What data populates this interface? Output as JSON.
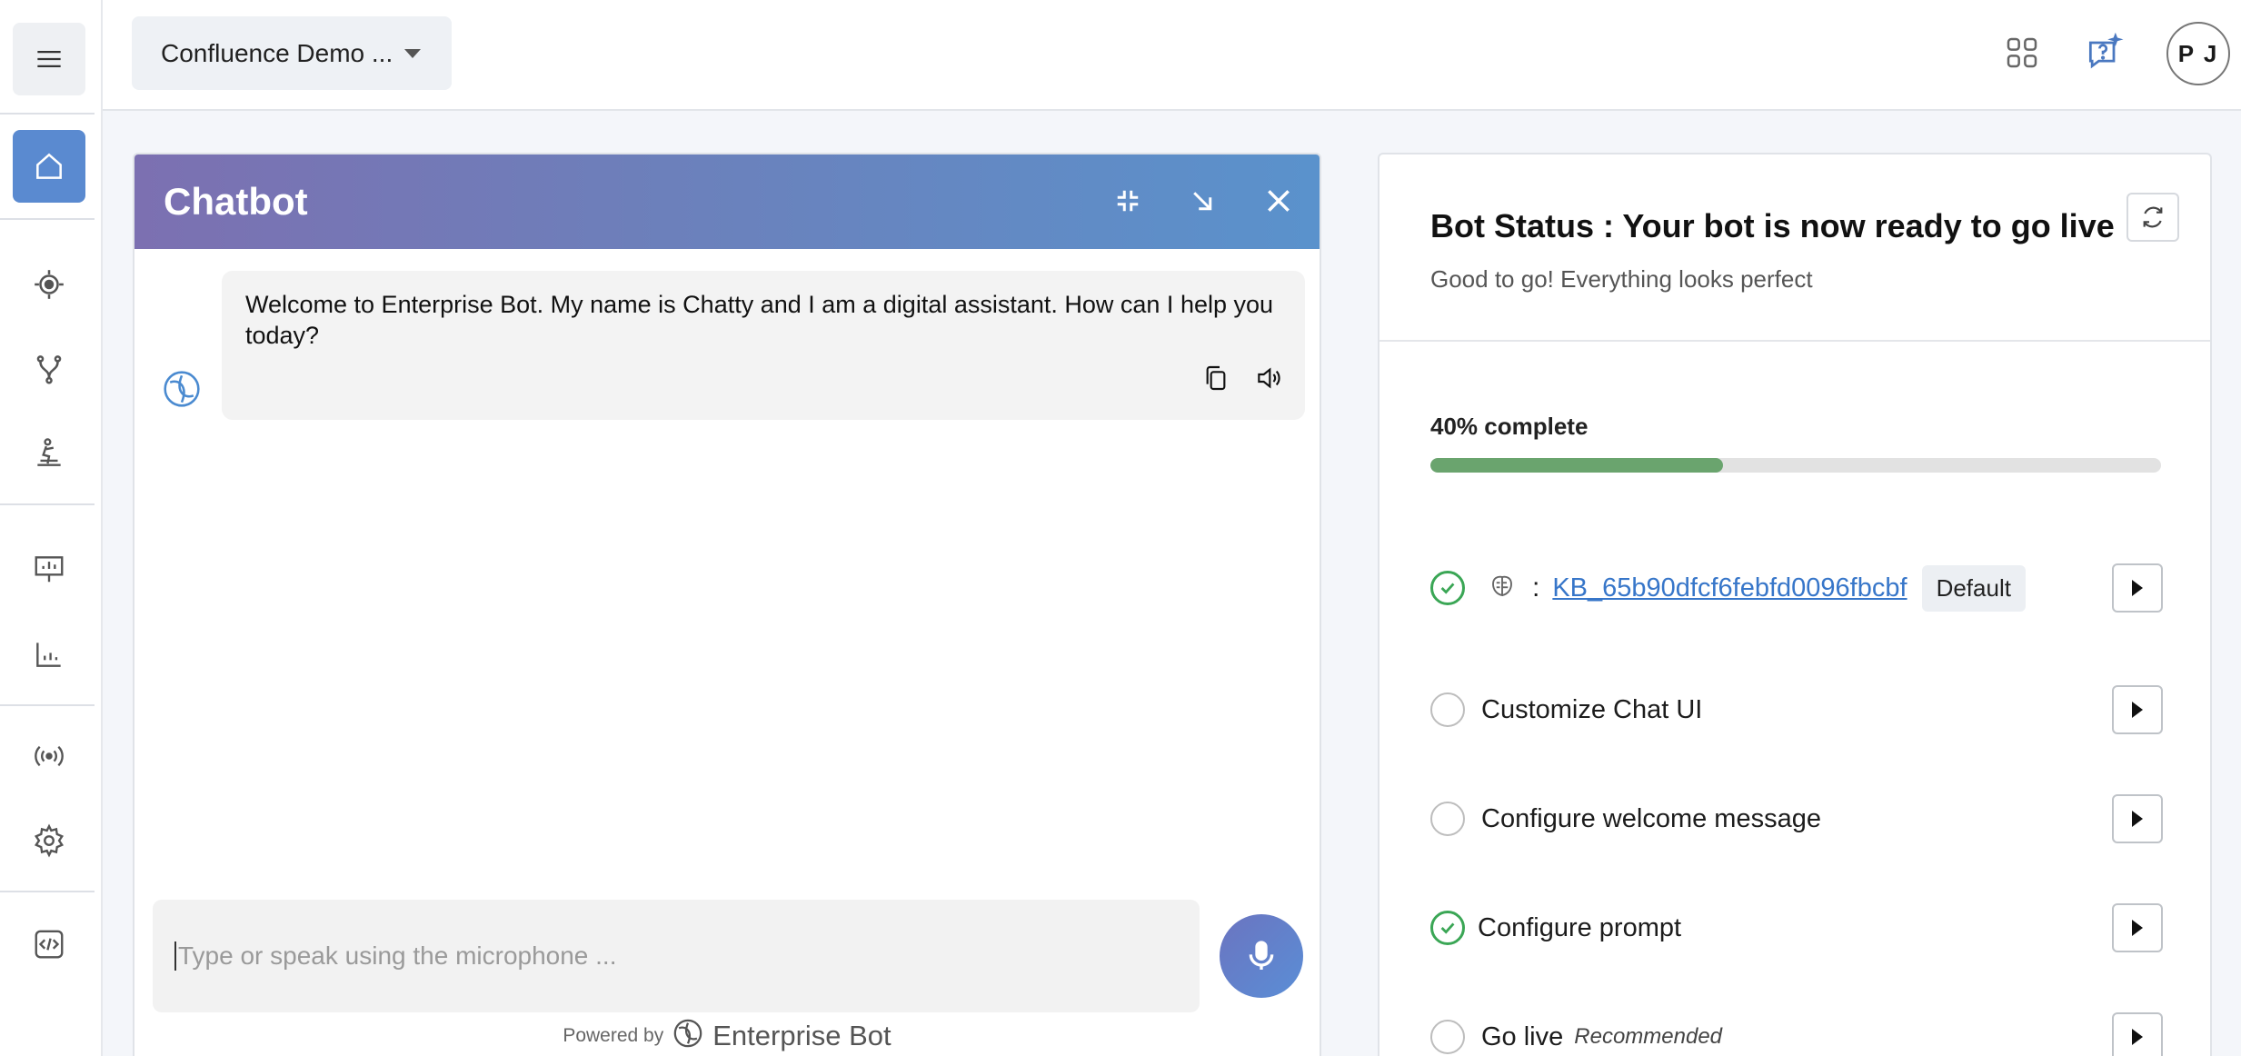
{
  "sidebar": {
    "items": [
      {
        "name": "menu-icon"
      },
      {
        "name": "home-icon"
      },
      {
        "name": "target-icon"
      },
      {
        "name": "flow-branch-icon"
      },
      {
        "name": "training-icon"
      },
      {
        "name": "presentation-icon"
      },
      {
        "name": "analytics-chart-icon"
      },
      {
        "name": "broadcast-icon"
      },
      {
        "name": "settings-gear-icon"
      },
      {
        "name": "code-embed-icon"
      }
    ],
    "active_item": "home-icon",
    "active_color": "#5a8ad0"
  },
  "topbar": {
    "project_name": "Confluence Demo ...",
    "avatar_initials": "P J"
  },
  "chatbot": {
    "title": "Chatbot",
    "welcome_message": "Welcome to Enterprise Bot. My name is Chatty and I am a digital assistant. How can I help you today?",
    "input_placeholder": "Type or speak using the microphone ...",
    "powered_by": "Powered by",
    "brand": "Enterprise Bot"
  },
  "bot_status": {
    "title": "Bot Status : Your bot is now ready to go live",
    "subtitle": "Good to go! Everything looks perfect",
    "progress_label": "40% complete",
    "progress": 0.4,
    "progress_color": "#6aa46e",
    "steps": [
      {
        "type": "kb",
        "done": true,
        "colon": ":",
        "link": "KB_65b90dfcf6febfd0096fbcbf",
        "badge": "Default"
      },
      {
        "label": "Customize Chat UI",
        "done": false
      },
      {
        "label": "Configure welcome message",
        "done": false
      },
      {
        "label": "Configure prompt",
        "done": true
      },
      {
        "label": "Go live",
        "done": false,
        "note": "Recommended"
      }
    ]
  }
}
